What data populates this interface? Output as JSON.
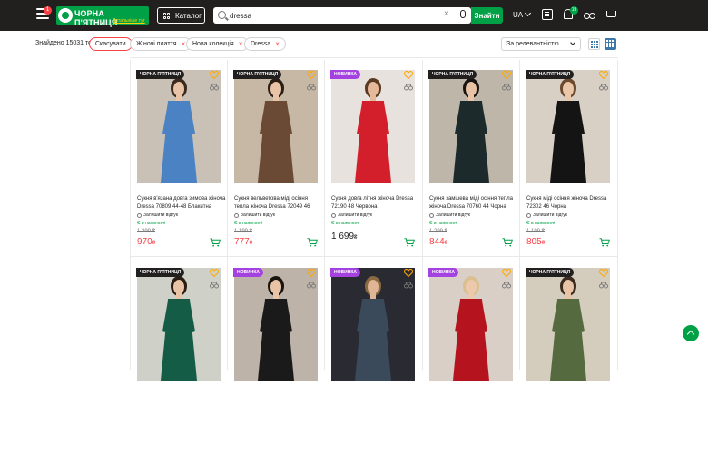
{
  "header": {
    "menu_badge": "1",
    "logo_title": "ЧОРНА П'ЯТНИЦЯ",
    "logo_subtitle": "Детальніше тут",
    "catalog_label": "Каталог",
    "search_value": "dressa",
    "search_button": "Знайти",
    "language": "UA",
    "notifications_count": "19",
    "icons": [
      "menu-icon",
      "catalog-grid-icon",
      "search-icon",
      "clear-icon",
      "microphone-icon",
      "orders-icon",
      "bell-icon",
      "compare-icon",
      "cart-icon"
    ]
  },
  "filters": {
    "found_text": "Знайдено 15031 товар",
    "reset_label": "Скасувати",
    "chips": [
      "Жіночі плаття",
      "Нова колекція",
      "Dressa"
    ],
    "sort_value": "За релевантністю"
  },
  "products": [
    {
      "badge": "ЧОРНА П'ЯТНИЦЯ",
      "badge_type": "black-friday",
      "title": "Сукня в'язана довга зимова жіноча Dressa 70809 44-48 Блакитна",
      "review": "Залишити відгук",
      "stock": "Є в наявності",
      "old_price": "1 399 ₴",
      "price": "970",
      "currency": "₴",
      "sale": true
    },
    {
      "badge": "ЧОРНА П'ЯТНИЦЯ",
      "badge_type": "black-friday",
      "title": "Сукня вельветова міді осіння тепла жіноча Dressa 72049 46",
      "review": "Залишити відгук",
      "stock": "Є в наявності",
      "old_price": "1 199 ₴",
      "price": "777",
      "currency": "₴",
      "sale": true
    },
    {
      "badge": "НОВИНКА",
      "badge_type": "new",
      "title": "Сукня довга літня жіноча Dressa 72190 48 Червона",
      "review": "Залишити відгук",
      "stock": "Є в наявності",
      "old_price": "",
      "price": "1 699",
      "currency": "₴",
      "sale": false
    },
    {
      "badge": "ЧОРНА П'ЯТНИЦЯ",
      "badge_type": "black-friday",
      "title": "Сукня замшева міді осіння тепла жіноча Dressa 70760 44 Чорна",
      "review": "Залишити відгук",
      "stock": "Є в наявності",
      "old_price": "1 299 ₴",
      "price": "844",
      "currency": "₴",
      "sale": true
    },
    {
      "badge": "ЧОРНА П'ЯТНИЦЯ",
      "badge_type": "black-friday",
      "title": "Сукня міді осіння жіноча Dressa 72302 46 Чорна",
      "review": "Залишити відгук",
      "stock": "Є в наявності",
      "old_price": "1 199 ₴",
      "price": "805",
      "currency": "₴",
      "sale": true
    },
    {
      "badge": "ЧОРНА П'ЯТНИЦЯ",
      "badge_type": "black-friday",
      "title": "",
      "review": "",
      "stock": "",
      "old_price": "",
      "price": "",
      "currency": "",
      "sale": true
    },
    {
      "badge": "НОВИНКА",
      "badge_type": "new",
      "title": "",
      "review": "",
      "stock": "",
      "old_price": "",
      "price": "",
      "currency": "",
      "sale": false
    },
    {
      "badge": "НОВИНКА",
      "badge_type": "new",
      "title": "",
      "review": "",
      "stock": "",
      "old_price": "",
      "price": "",
      "currency": "",
      "sale": false
    },
    {
      "badge": "НОВИНКА",
      "badge_type": "new",
      "title": "",
      "review": "",
      "stock": "",
      "old_price": "",
      "price": "",
      "currency": "",
      "sale": false
    },
    {
      "badge": "ЧОРНА П'ЯТНИЦЯ",
      "badge_type": "black-friday",
      "title": "",
      "review": "",
      "stock": "",
      "old_price": "",
      "price": "",
      "currency": "",
      "sale": true
    }
  ],
  "colors": {
    "header_bg": "#221f1f",
    "brand_green": "#00a046",
    "sale_red": "#f84147",
    "new_badge": "#a442e1",
    "favorite_orange": "#ffa900"
  }
}
